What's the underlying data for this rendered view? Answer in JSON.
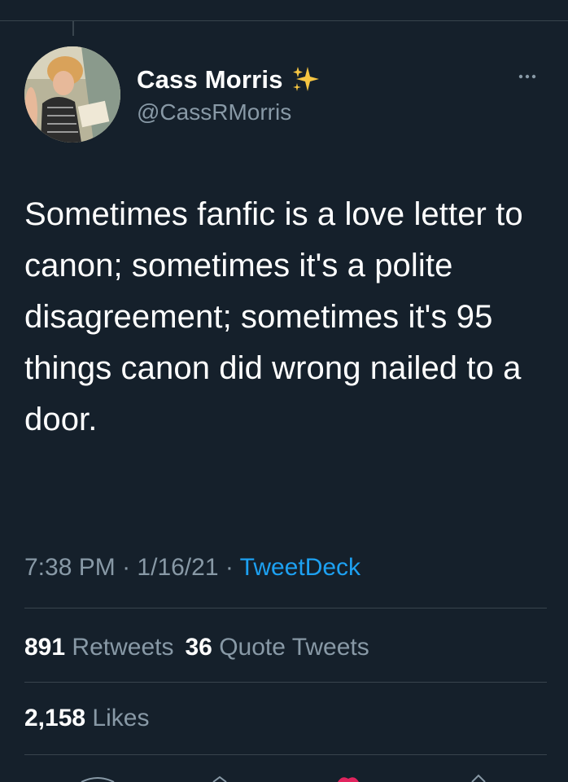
{
  "tweet": {
    "author_name": "Cass Morris",
    "author_handle": "@CassRMorris",
    "text": "Sometimes fanfic is a love letter to canon; sometimes it's a polite disagreement; sometimes it's 95 things canon did wrong nailed to a door.",
    "time": "7:38 PM",
    "separator": "·",
    "date": "1/16/21",
    "source": "TweetDeck"
  },
  "stats": {
    "retweets_count": "891",
    "retweets_label": "Retweets",
    "quotes_count": "36",
    "quotes_label": "Quote Tweets",
    "likes_count": "2,158",
    "likes_label": "Likes"
  },
  "icons": {
    "sparkle": "sparkles-icon",
    "more": "more-options-icon"
  },
  "colors": {
    "background": "#15202b",
    "secondary_text": "#8899a6",
    "accent": "#1da1f2",
    "divider": "#38444d",
    "sparkle": "#f5c542"
  }
}
